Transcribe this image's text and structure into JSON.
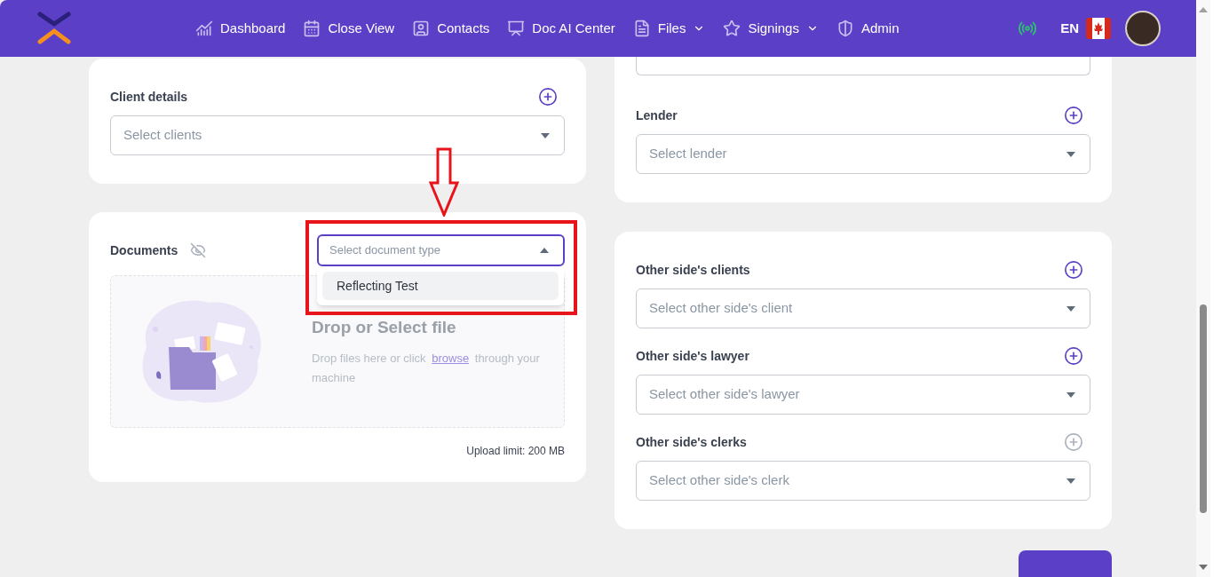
{
  "nav": {
    "items": [
      {
        "label": "Dashboard",
        "dropdown": false
      },
      {
        "label": "Close View",
        "dropdown": false
      },
      {
        "label": "Contacts",
        "dropdown": false
      },
      {
        "label": "Doc AI Center",
        "dropdown": false
      },
      {
        "label": "Files",
        "dropdown": true
      },
      {
        "label": "Signings",
        "dropdown": true
      },
      {
        "label": "Admin",
        "dropdown": false
      }
    ],
    "language": "EN"
  },
  "client_details": {
    "label": "Client details",
    "placeholder": "Select clients",
    "add_disabled": false
  },
  "documents": {
    "label": "Documents",
    "type_select": {
      "placeholder": "Select document type",
      "open": true,
      "options": [
        {
          "label": "Reflecting Test",
          "selected": false
        }
      ]
    },
    "dropzone": {
      "title": "Drop or Select file",
      "text_before": "Drop files here or click",
      "link": "browse",
      "text_after": "through your machine"
    },
    "limit": "Upload limit: 200 MB"
  },
  "lender": {
    "label": "Lender",
    "placeholder": "Select lender",
    "add_disabled": false
  },
  "other_side": [
    {
      "label": "Other side's clients",
      "placeholder": "Select other side's client",
      "add_disabled": false
    },
    {
      "label": "Other side's lawyer",
      "placeholder": "Select other side's lawyer",
      "add_disabled": false
    },
    {
      "label": "Other side's clerks",
      "placeholder": "Select other side's clerk",
      "add_disabled": true
    }
  ]
}
